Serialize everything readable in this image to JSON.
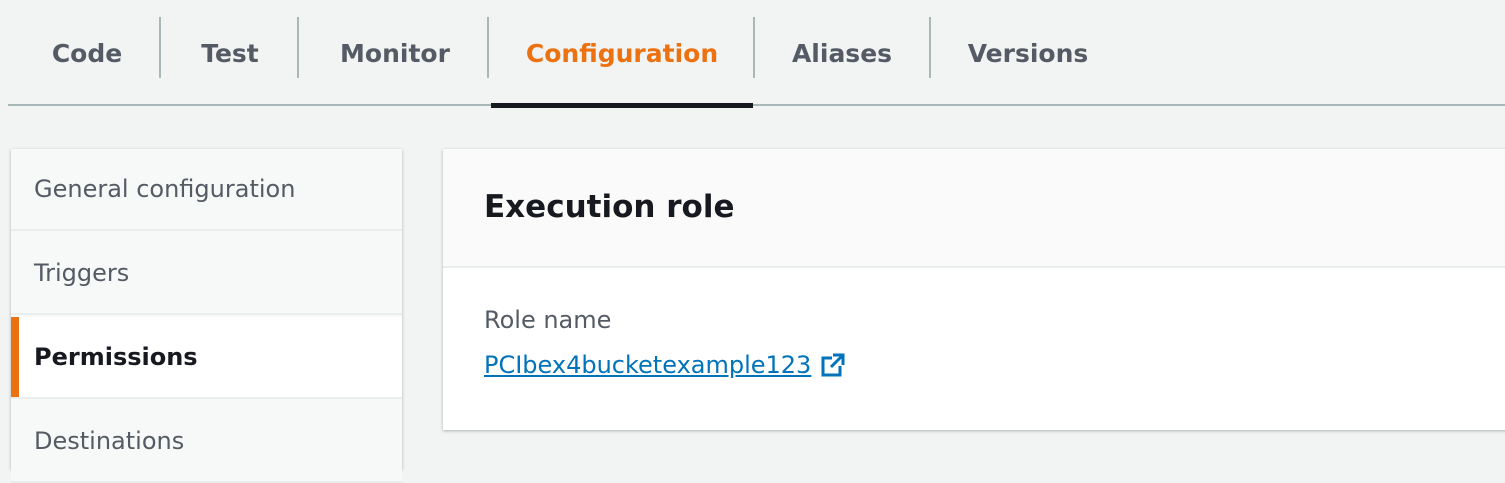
{
  "tabs": [
    {
      "label": "Code",
      "active": false
    },
    {
      "label": "Test",
      "active": false
    },
    {
      "label": "Monitor",
      "active": false
    },
    {
      "label": "Configuration",
      "active": true
    },
    {
      "label": "Aliases",
      "active": false
    },
    {
      "label": "Versions",
      "active": false
    }
  ],
  "sidebar": {
    "items": [
      {
        "label": "General configuration",
        "active": false
      },
      {
        "label": "Triggers",
        "active": false
      },
      {
        "label": "Permissions",
        "active": true
      },
      {
        "label": "Destinations",
        "active": false
      }
    ]
  },
  "panel": {
    "title": "Execution role",
    "role_label": "Role name",
    "role_value": "PCIbex4bucketexample123",
    "role_icon": "external-link-icon"
  },
  "colors": {
    "accent": "#ec7211",
    "link": "#0073bb",
    "text": "#16191f",
    "muted": "#545b64"
  }
}
